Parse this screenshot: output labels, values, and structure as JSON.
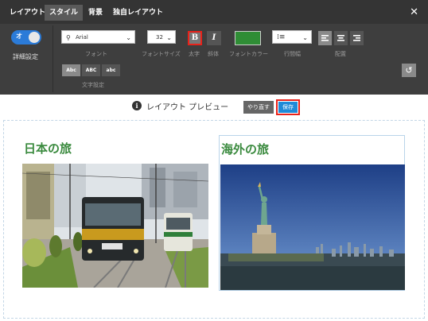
{
  "tabs": [
    {
      "label": "レイアウト"
    },
    {
      "label": "スタイル"
    },
    {
      "label": "背景"
    },
    {
      "label": "独自レイアウト"
    }
  ],
  "toggle": {
    "label": "オ",
    "caption": "詳細設定"
  },
  "font": {
    "value": "Arial",
    "caption": "フォント"
  },
  "font_size": {
    "value": "32",
    "caption": "フォントサイズ"
  },
  "bold": {
    "glyph": "B",
    "caption": "太字"
  },
  "italic": {
    "glyph": "I",
    "caption": "斜体"
  },
  "font_color": {
    "caption": "フォントカラー",
    "value": "#2f8d35"
  },
  "line_spacing": {
    "caption": "行間幅"
  },
  "alignment": {
    "caption": "配置"
  },
  "text_case": {
    "options": [
      "Abc",
      "ABC",
      "abc"
    ],
    "caption": "文字設定"
  },
  "preview": {
    "title": "レイアウト プレビュー",
    "redo_label": "やり直す",
    "save_label": "保存"
  },
  "cards": [
    {
      "title": "日本の旅"
    },
    {
      "title": "海外の旅"
    }
  ],
  "colors": {
    "accent": "#2b7bd8",
    "highlight": "#e8221a",
    "title_green": "#3a8a3e"
  }
}
